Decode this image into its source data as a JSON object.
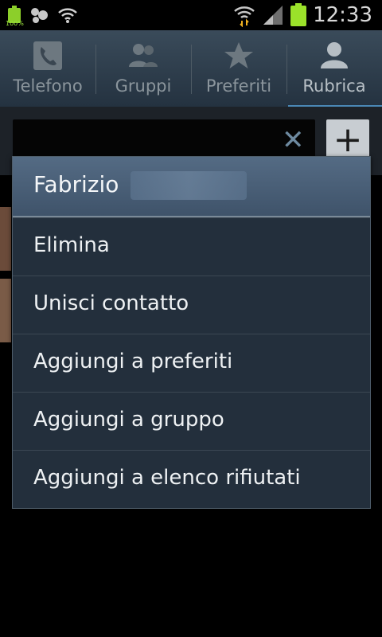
{
  "status_bar": {
    "time": "12:33",
    "battery_small_text": "100%",
    "icons": [
      "battery-notification-icon",
      "android-debug-icon",
      "wifi-icon",
      "wifi-signal-icon",
      "cell-signal-icon",
      "battery-icon"
    ]
  },
  "tabs": [
    {
      "label": "Telefono",
      "icon": "phone-icon",
      "active": false
    },
    {
      "label": "Gruppi",
      "icon": "groups-icon",
      "active": false
    },
    {
      "label": "Preferiti",
      "icon": "star-icon",
      "active": false
    },
    {
      "label": "Rubrica",
      "icon": "contact-icon",
      "active": true
    }
  ],
  "search": {
    "clear_icon": "close-icon",
    "add_icon": "plus-icon"
  },
  "context_menu": {
    "title": "Fabrizio",
    "items": [
      {
        "label": "Elimina"
      },
      {
        "label": "Unisci contatto"
      },
      {
        "label": "Aggiungi a preferiti"
      },
      {
        "label": "Aggiungi a gruppo"
      },
      {
        "label": "Aggiungi a elenco rifiutati"
      }
    ]
  },
  "colors": {
    "accent": "#4a87b5",
    "menu_bg": "#232f3c",
    "menu_header": "#4b6078"
  }
}
